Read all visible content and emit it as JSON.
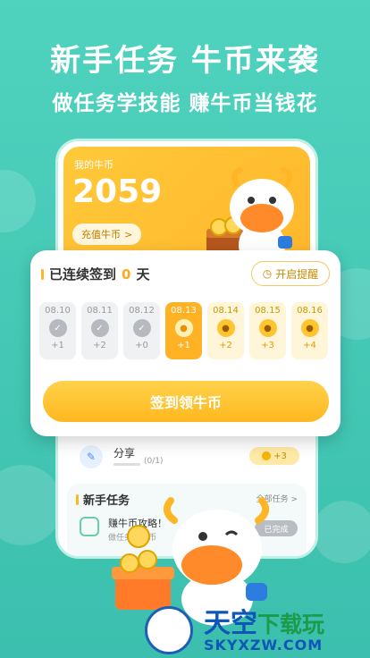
{
  "headline": {
    "title": "新手任务  牛币来袭",
    "subtitle": "做任务学技能  赚牛币当钱花"
  },
  "coins": {
    "label": "我的牛币",
    "value": "2059",
    "recharge_label": "充值牛币",
    "recharge_chevron": ">"
  },
  "signin": {
    "title_prefix": "已连续签到",
    "streak": "0",
    "title_suffix": "天",
    "remind_label": "开启提醒",
    "button_label": "签到领牛币",
    "days": [
      {
        "date": "08.10",
        "bonus": "+1",
        "state": "done"
      },
      {
        "date": "08.11",
        "bonus": "+2",
        "state": "done"
      },
      {
        "date": "08.12",
        "bonus": "+0",
        "state": "done"
      },
      {
        "date": "08.13",
        "bonus": "+1",
        "state": "today"
      },
      {
        "date": "08.14",
        "bonus": "+2",
        "state": "future"
      },
      {
        "date": "08.15",
        "bonus": "+3",
        "state": "future"
      },
      {
        "date": "08.16",
        "bonus": "+4",
        "state": "future"
      }
    ]
  },
  "share_task": {
    "name": "分享",
    "progress": "(0/1)",
    "reward": "+3"
  },
  "newbie": {
    "title": "新手任务",
    "all_tasks": "全部任务 >",
    "task": {
      "name": "赚牛币攻略！",
      "subtitle": "做任务赚牛币",
      "status": "已完成"
    }
  },
  "watermark": {
    "brand_a": "天空",
    "brand_b": "下载玩",
    "domain": "SKYXZW.COM"
  },
  "colors": {
    "primary_teal": "#44c8b5",
    "coin_orange": "#ffb62a",
    "accent": "#ffa81f"
  }
}
